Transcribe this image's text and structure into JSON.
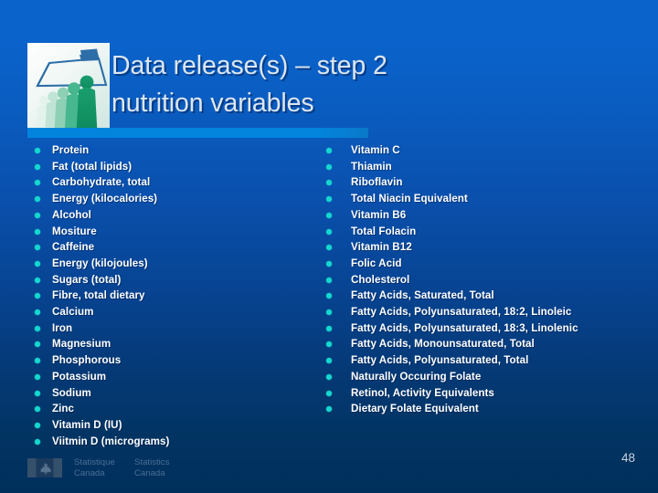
{
  "slide": {
    "title_lines": [
      "Data release(s) – step 2",
      "nutrition variables"
    ],
    "page_number": "48",
    "colors": {
      "background_top": "#0a63cb",
      "background_bottom": "#002f5b",
      "accent_bar": "#0284dd",
      "bullet": "#16d7cf",
      "title_text": "#dce6f0",
      "body_text": "#ffffff",
      "footer_text": "#4b6e93"
    }
  },
  "logo": {
    "name": "statistics-canada-people-logo",
    "description": "blue trapezoid outline above green human figures on light gradient"
  },
  "columns": {
    "left": [
      "Protein",
      "Fat (total lipids)",
      "Carbohydrate, total",
      "Energy (kilocalories)",
      "Alcohol",
      "Mositure",
      "Caffeine",
      "Energy (kilojoules)",
      "Sugars (total)",
      "Fibre, total dietary",
      "Calcium",
      "Iron",
      "Magnesium",
      "Phosphorous",
      "Potassium",
      "Sodium",
      "Zinc",
      "Vitamin D (IU)",
      "Viitmin D (micrograms)"
    ],
    "right": [
      "Vitamin C",
      "Thiamin",
      "Riboflavin",
      "Total Niacin Equivalent",
      "Vitamin B6",
      "Total Folacin",
      "Vitamin B12",
      "Folic Acid",
      "Cholesterol",
      "Fatty Acids, Saturated, Total",
      "Fatty Acids, Polyunsaturated, 18:2, Linoleic",
      "Fatty Acids, Polyunsaturated, 18:3, Linolenic",
      "Fatty Acids, Monounsaturated, Total",
      "Fatty Acids, Polyunsaturated, Total",
      "Naturally Occuring Folate",
      "Retinol, Activity Equivalents",
      "Dietary Folate Equivalent"
    ]
  },
  "footer": {
    "agency_fr": {
      "line1": "Statistique",
      "line2": "Canada"
    },
    "agency_en": {
      "line1": "Statistics",
      "line2": "Canada"
    },
    "flag_icon": "canada-flag-icon"
  }
}
